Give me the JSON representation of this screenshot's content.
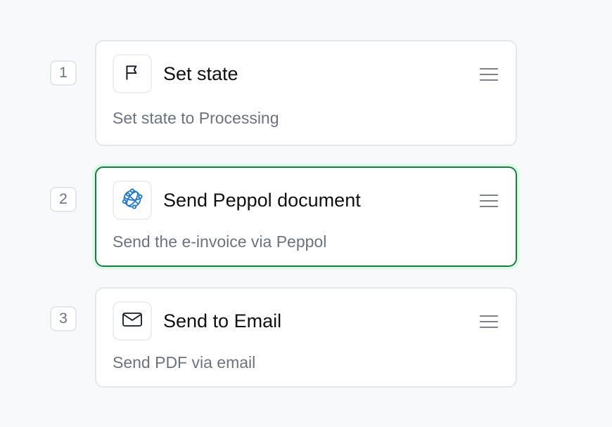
{
  "steps": [
    {
      "number": "1",
      "title": "Set state",
      "description": "Set state to Processing",
      "icon": "flag-icon",
      "active": false
    },
    {
      "number": "2",
      "title": "Send Peppol document",
      "description": "Send the e-invoice via Peppol",
      "icon": "peppol-network-icon",
      "active": true
    },
    {
      "number": "3",
      "title": "Send to Email",
      "description": "Send PDF via email",
      "icon": "mail-icon",
      "active": false
    }
  ],
  "colors": {
    "background": "#f8f9fb",
    "card_border": "#e5e7eb",
    "active_border": "#15803d",
    "active_glow": "#dcfce7",
    "peppol_blue": "#1f78d1",
    "muted_text": "#6b7280"
  }
}
